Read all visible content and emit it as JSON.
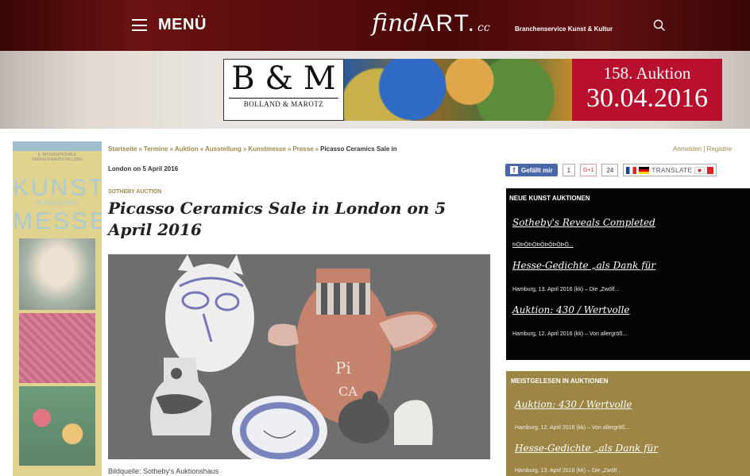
{
  "header": {
    "menu_label": "MENÜ",
    "logo_find": "find",
    "logo_art": "ART.",
    "logo_cc": "cc",
    "tagline": "Branchenservice Kunst & Kultur"
  },
  "ad": {
    "brand": "B & M",
    "brand_sub": "BOLLAND & MAROTZ",
    "auction": "158. Auktion",
    "date": "30.04.2016",
    "accent": "#b80f2c"
  },
  "sidebar_ad": {
    "small_text": "8. INTERNATIONALE VERKAUFSAUSSTELLUNG",
    "word1": "KUNST",
    "middle": "& Antiquitäten",
    "word2": "MESSE"
  },
  "breadcrumb": {
    "items": [
      "Startseite",
      "Termine",
      "Auktion",
      "Ausstellung",
      "Kunstmesse",
      "Presse"
    ],
    "separator": "»",
    "current": "Picasso Ceramics Sale in",
    "current_cont": "London on 5 April 2016"
  },
  "user_links": {
    "login": "Anmelden",
    "divider": "|",
    "register": "Registrie"
  },
  "article": {
    "category": "SOTHEBY AUCTION",
    "title": "Picasso Ceramics Sale in London on 5 April 2016",
    "caption": "Bildquelle: Sotheby's Auktionshaus"
  },
  "social": {
    "like_label": "Gefällt mir",
    "like_count": "1",
    "gplus_label": "G+1",
    "gplus_count": "24",
    "translate_label": "TRANSLATE"
  },
  "box1": {
    "title": "NEUE KUNST AUKTIONEN",
    "items": [
      {
        "title": "Sotheby's Reveals Completed",
        "meta": ""
      },
      {
        "title": "",
        "meta": ""
      },
      {
        "title": "Hesse-Gedichte „als Dank für",
        "meta": "Hamburg, 13. April 2016 (kk) – Die „Zwölf..."
      },
      {
        "title": "Auktion: 430 / Wertvolle",
        "meta": "Hamburg, 12. April 2016 (kk) – Von allergröß..."
      }
    ],
    "garbled": "ÞÖÞÖÞÖÞÖÞÖÞÖÞÖ..."
  },
  "box2": {
    "title": "MEISTGELESEN IN AUKTIONEN",
    "items": [
      {
        "title": "Auktion: 430 / Wertvolle",
        "meta": "Hamburg, 12. April 2016 (kk) – Von allergröß..."
      },
      {
        "title": "Hesse-Gedichte „als Dank für",
        "meta": "Hamburg, 13. April 2016 (kk) – Die „Zwölf..."
      }
    ]
  }
}
